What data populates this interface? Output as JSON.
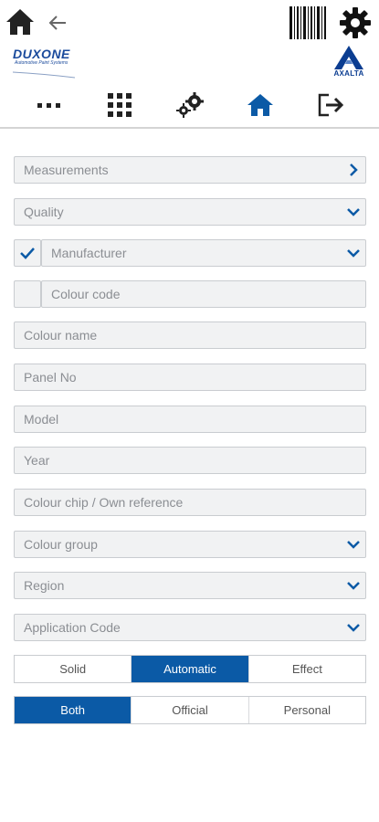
{
  "colors": {
    "brand_blue": "#0b5aa6",
    "field_bg": "#f1f2f3",
    "field_border": "#c9ccd0",
    "placeholder": "#8b8e93"
  },
  "header": {
    "home_icon": "home-icon",
    "back_icon": "arrow-left-icon",
    "barcode_icon": "barcode-icon",
    "settings_icon": "gear-icon",
    "left_logo": {
      "text": "DUXONE",
      "tagline": "Automotive Paint Systems"
    },
    "right_logo": {
      "text": "AXALTA"
    }
  },
  "nav": {
    "items": [
      {
        "icon": "more-dots-icon"
      },
      {
        "icon": "grid-icon"
      },
      {
        "icon": "gears-icon"
      },
      {
        "icon": "home-icon"
      },
      {
        "icon": "logout-icon"
      }
    ]
  },
  "form": {
    "measurements": {
      "label": "Measurements",
      "icon": "chevron-right-icon"
    },
    "quality": {
      "label": "Quality",
      "icon": "chevron-down-icon"
    },
    "manufacturer": {
      "label": "Manufacturer",
      "checked": true,
      "icon": "chevron-down-icon"
    },
    "colour_code": {
      "placeholder": "Colour code",
      "checked": false
    },
    "colour_name": {
      "placeholder": "Colour name"
    },
    "panel_no": {
      "placeholder": "Panel No"
    },
    "model": {
      "placeholder": "Model"
    },
    "year": {
      "placeholder": "Year"
    },
    "colour_chip": {
      "placeholder": "Colour chip / Own reference"
    },
    "colour_group": {
      "label": "Colour group",
      "icon": "chevron-down-icon"
    },
    "region": {
      "label": "Region",
      "icon": "chevron-down-icon"
    },
    "application_code": {
      "label": "Application Code",
      "icon": "chevron-down-icon"
    }
  },
  "finish_toggle": {
    "options": [
      "Solid",
      "Automatic",
      "Effect"
    ],
    "selected": "Automatic"
  },
  "source_toggle": {
    "options": [
      "Both",
      "Official",
      "Personal"
    ],
    "selected": "Both"
  }
}
